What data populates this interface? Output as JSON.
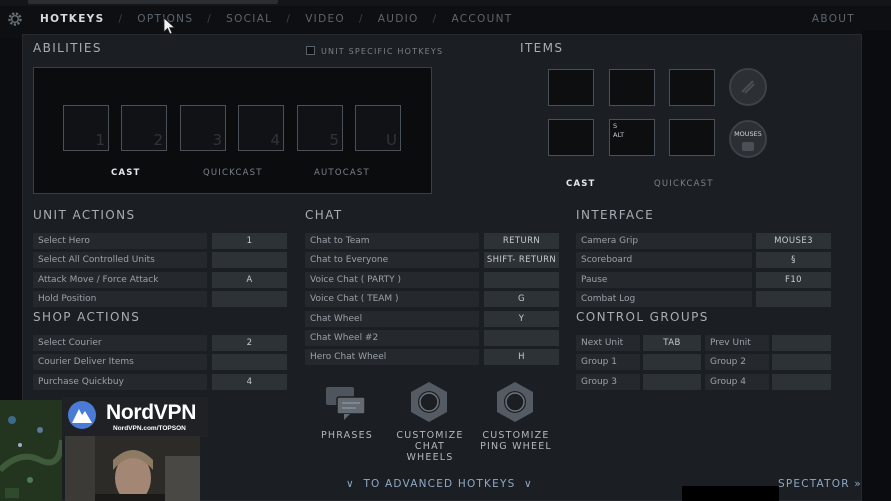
{
  "nav": {
    "tabs": [
      "HOTKEYS",
      "OPTIONS",
      "SOCIAL",
      "VIDEO",
      "AUDIO",
      "ACCOUNT"
    ],
    "about": "ABOUT"
  },
  "abilities": {
    "title": "ABILITIES",
    "unit_specific_label": "UNIT SPECIFIC HOTKEYS",
    "slots": [
      "1",
      "2",
      "3",
      "4",
      "5",
      "U"
    ],
    "modes": [
      "CAST",
      "QUICKCAST",
      "AUTOCAST"
    ]
  },
  "items": {
    "title": "ITEMS",
    "slot_key_line1": "S",
    "slot_key_line2": "ALT",
    "circle_label": "MOUSE5",
    "modes": [
      "CAST",
      "QUICKCAST"
    ]
  },
  "unit_actions": {
    "title": "UNIT ACTIONS",
    "rows": [
      {
        "label": "Select Hero",
        "key": "1"
      },
      {
        "label": "Select All Controlled Units",
        "key": ""
      },
      {
        "label": "Attack Move / Force Attack",
        "key": "A"
      },
      {
        "label": "Hold Position",
        "key": ""
      }
    ]
  },
  "shop_actions": {
    "title": "SHOP ACTIONS",
    "rows": [
      {
        "label": "Select Courier",
        "key": "2"
      },
      {
        "label": "Courier Deliver Items",
        "key": ""
      },
      {
        "label": "Purchase Quickbuy",
        "key": "4"
      }
    ]
  },
  "chat": {
    "title": "CHAT",
    "rows": [
      {
        "label": "Chat to Team",
        "key": "RETURN"
      },
      {
        "label": "Chat to Everyone",
        "key": "SHIFT- RETURN"
      },
      {
        "label": "Voice Chat ( PARTY )",
        "key": ""
      },
      {
        "label": "Voice Chat ( TEAM )",
        "key": "G"
      },
      {
        "label": "Chat Wheel",
        "key": "Y"
      },
      {
        "label": "Chat Wheel #2",
        "key": ""
      },
      {
        "label": "Hero Chat Wheel",
        "key": "H"
      }
    ],
    "buttons": [
      {
        "line1": "PHRASES",
        "line2": ""
      },
      {
        "line1": "CUSTOMIZE",
        "line2": "CHAT WHEELS"
      },
      {
        "line1": "CUSTOMIZE",
        "line2": "PING WHEEL"
      }
    ]
  },
  "interface": {
    "title": "INTERFACE",
    "rows": [
      {
        "label": "Camera Grip",
        "key": "MOUSE3"
      },
      {
        "label": "Scoreboard",
        "key": "§"
      },
      {
        "label": "Pause",
        "key": "F10"
      },
      {
        "label": "Combat Log",
        "key": ""
      }
    ]
  },
  "control_groups": {
    "title": "CONTROL GROUPS",
    "left": [
      {
        "label": "Next Unit",
        "key": "TAB"
      },
      {
        "label": "Group 1",
        "key": ""
      },
      {
        "label": "Group 3",
        "key": ""
      }
    ],
    "right": [
      {
        "label": "Prev Unit",
        "key": ""
      },
      {
        "label": "Group 2",
        "key": ""
      },
      {
        "label": "Group 4",
        "key": ""
      }
    ]
  },
  "footer": {
    "advanced": "TO ADVANCED HOTKEYS",
    "spectator": "SPECTATOR"
  },
  "overlay": {
    "brand": "NordVPN",
    "url": "NordVPN.com/TOPSON"
  }
}
